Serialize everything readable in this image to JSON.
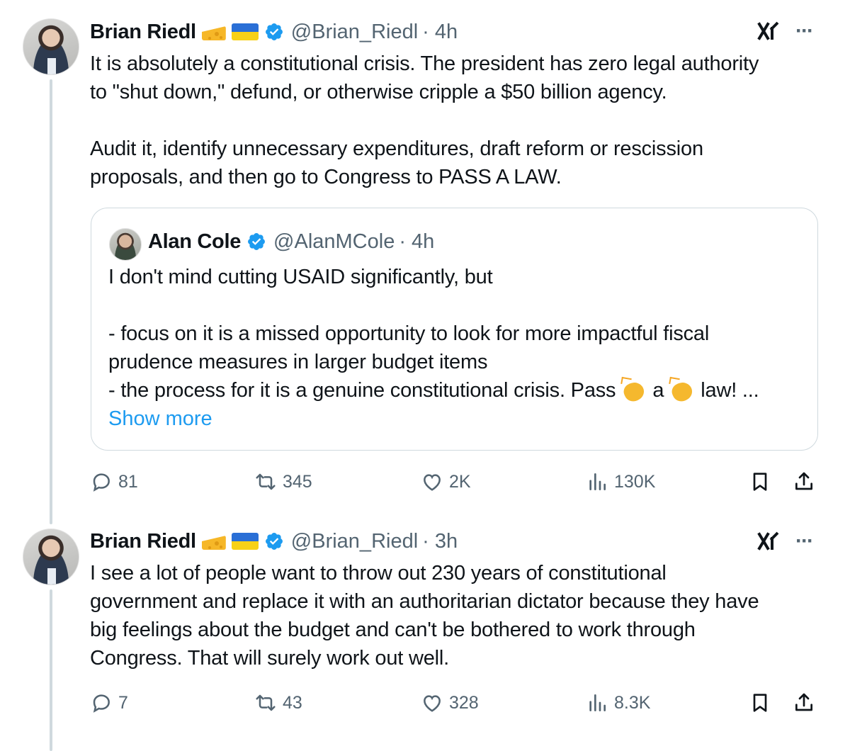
{
  "tweets": [
    {
      "author": {
        "name": "Brian Riedl",
        "handle": "@Brian_Riedl",
        "time": "· 4h",
        "badges": [
          "cheese-emoji",
          "ukraine-flag",
          "verified-badge"
        ]
      },
      "text": "It is absolutely a constitutional crisis. The president has zero legal authority\nto \"shut down,\" defund, or otherwise cripple a $50 billion agency.\n\nAudit it, identify unnecessary expenditures, draft reform or rescission\nproposals, and then go to Congress to PASS A LAW.",
      "quote": {
        "author": {
          "name": "Alan Cole",
          "handle": "@AlanMCole",
          "time": "· 4h"
        },
        "text_main": "I don't mind cutting USAID significantly, but\n\n- focus on it is a missed opportunity to look for more impactful fiscal\nprudence measures in larger budget items\n- the process for it is a genuine constitutional crisis. Pass",
        "text_a": "a",
        "text_end": "law! ...",
        "show_more": "Show more"
      },
      "stats": {
        "replies": "81",
        "reposts": "345",
        "likes": "2K",
        "views": "130K"
      }
    },
    {
      "author": {
        "name": "Brian Riedl",
        "handle": "@Brian_Riedl",
        "time": "· 3h",
        "badges": [
          "cheese-emoji",
          "ukraine-flag",
          "verified-badge"
        ]
      },
      "text": "I see a lot of people want to throw out 230 years of constitutional\ngovernment and replace it with an authoritarian dictator because they have\nbig feelings about the budget and can't be bothered to work through\nCongress. That will surely work out well.",
      "stats": {
        "replies": "7",
        "reposts": "43",
        "likes": "328",
        "views": "8.3K"
      }
    }
  ],
  "icons": {
    "more": "more-icon",
    "grok": "grok-icon",
    "reply": "reply-icon",
    "repost": "repost-icon",
    "like": "like-icon",
    "views": "views-icon",
    "bookmark": "bookmark-icon",
    "share": "share-icon"
  },
  "colors": {
    "accent": "#1d9bf0",
    "muted": "#536471",
    "border": "#cfd9de",
    "text": "#0f1419"
  }
}
